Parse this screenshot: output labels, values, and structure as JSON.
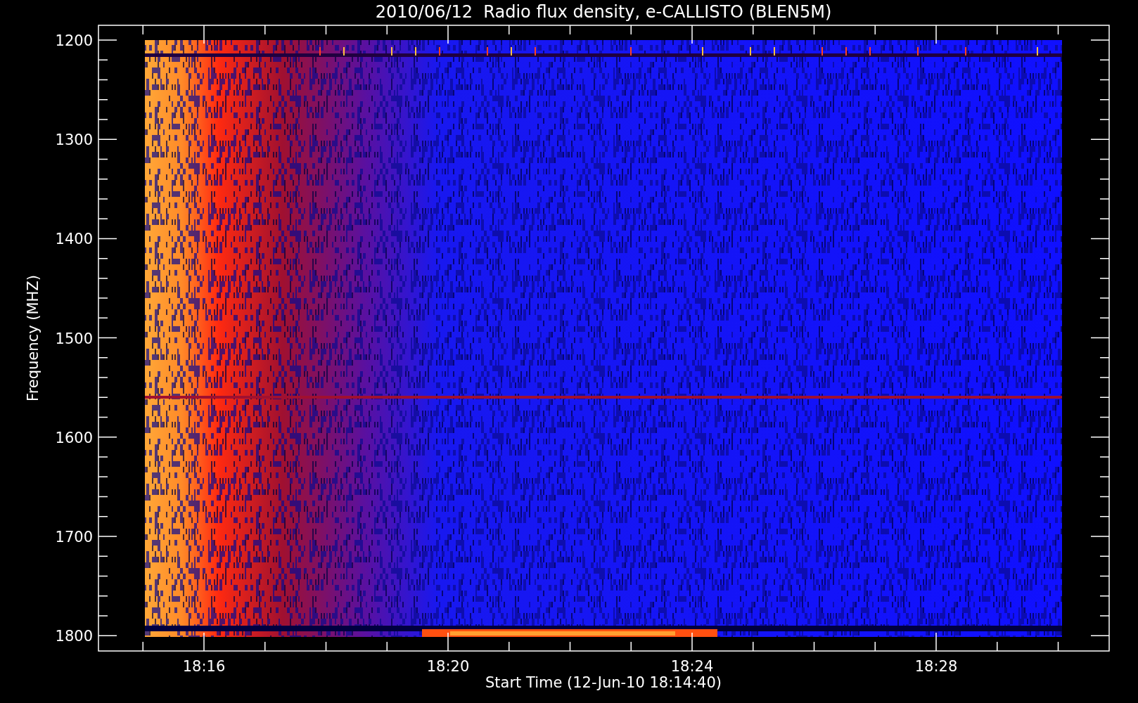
{
  "title": "2010/06/12  Radio flux density, e-CALLISTO (BLEN5M)",
  "y_axis": {
    "label": "Frequency (MHZ)",
    "ticks": [
      "1200",
      "1300",
      "1400",
      "1500",
      "1600",
      "1700",
      "1800"
    ]
  },
  "x_axis": {
    "label": "Start Time (12-Jun-10 18:14:40)",
    "ticks": [
      "18:16",
      "18:20",
      "18:24",
      "18:28"
    ]
  }
}
